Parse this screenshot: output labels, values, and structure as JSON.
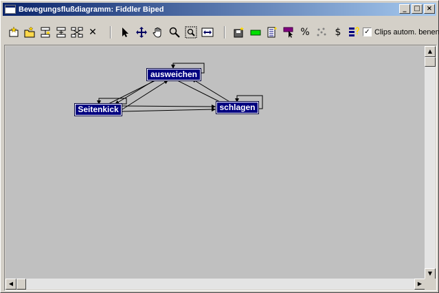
{
  "window": {
    "title": "Bewegungsflußdiagramm: Fiddler Biped",
    "buttons": {
      "minimize": "_",
      "maximize": "□",
      "close": "×"
    }
  },
  "toolbar": {
    "tools": [
      {
        "name": "new-clip-icon"
      },
      {
        "name": "open-clip-icon"
      },
      {
        "name": "add-transition-icon"
      },
      {
        "name": "insert-transition-icon"
      },
      {
        "name": "multi-transition-icon"
      },
      {
        "name": "delete-icon"
      },
      {
        "name": "select-arrow-icon"
      },
      {
        "name": "move-icon"
      },
      {
        "name": "pan-hand-icon"
      },
      {
        "name": "zoom-icon"
      },
      {
        "name": "zoom-region-icon"
      },
      {
        "name": "fit-extents-icon"
      },
      {
        "name": "save-motion-icon"
      },
      {
        "name": "green-clip-icon"
      },
      {
        "name": "list-icon"
      },
      {
        "name": "purple-marker-icon"
      },
      {
        "name": "percent-icon"
      },
      {
        "name": "random-icon"
      },
      {
        "name": "dollar-icon"
      },
      {
        "name": "properties-icon"
      }
    ],
    "percent_label": "%",
    "dollar_label": "$",
    "delete_label": "✕",
    "clips_checkbox": {
      "label": "Clips autom. benen",
      "checked": true,
      "mark": "✓"
    }
  },
  "diagram": {
    "nodes": [
      {
        "id": "ausweichen",
        "label": "ausweichen"
      },
      {
        "id": "seitenkick",
        "label": "Seitenkick"
      },
      {
        "id": "schlagen",
        "label": "schlagen"
      }
    ]
  },
  "scrollbars": {
    "up": "▲",
    "down": "▼",
    "left": "◀",
    "right": "▶"
  },
  "colors": {
    "node_bg": "#000080",
    "canvas_bg": "#c0c0c0",
    "title_start": "#0a246a",
    "title_end": "#a6caf0"
  }
}
